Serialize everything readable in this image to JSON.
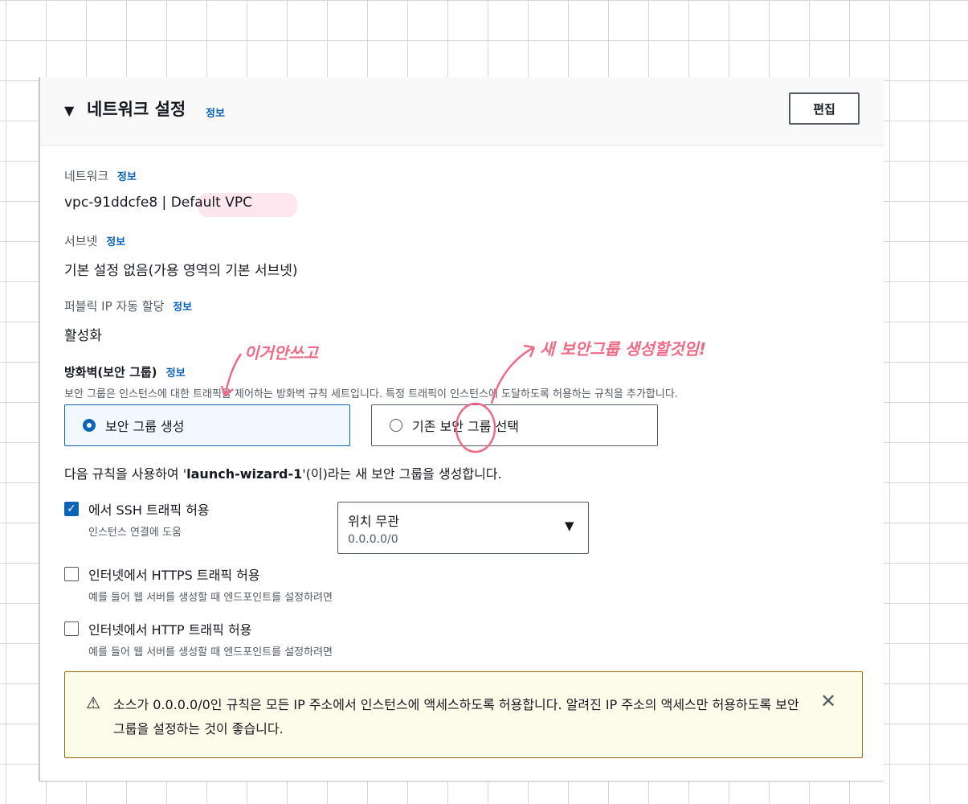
{
  "panel": {
    "title": "네트워크 설정",
    "title_info": "정보",
    "edit_label": "편집"
  },
  "network": {
    "label": "네트워크",
    "info": "정보",
    "value": "vpc-91ddcfe8 | Default VPC"
  },
  "subnet": {
    "label": "서브넷",
    "info": "정보",
    "value": "기본 설정 없음(가용 영역의 기본 서브넷)"
  },
  "public_ip": {
    "label": "퍼블릭 IP 자동 할당",
    "info": "정보",
    "value": "활성화"
  },
  "firewall": {
    "label": "방화벽(보안 그룹)",
    "info": "정보",
    "description": "보안 그룹은 인스턴스에 대한 트래픽을 제어하는 방화벽 규칙 세트입니다. 특정 트래픽이 인스턴스에 도달하도록 허용하는 규칙을 추가합니다.",
    "options": [
      {
        "label": "보안 그룹 생성",
        "selected": true
      },
      {
        "label": "기존 보안 그룹 선택",
        "selected": false
      }
    ],
    "rule_text_prefix": "다음 규칙을 사용하여 '",
    "rule_group_name": "launch-wizard-1",
    "rule_text_suffix": "'(이)라는 새 보안 그룹을 생성합니다."
  },
  "rules": [
    {
      "label": "에서 SSH 트래픽 허용",
      "description": "인스턴스 연결에 도움",
      "checked": true
    },
    {
      "label": "인터넷에서 HTTPS 트래픽 허용",
      "description": "예를 들어 웹 서버를 생성할 때 엔드포인트를 설정하려면",
      "checked": false
    },
    {
      "label": "인터넷에서 HTTP 트래픽 허용",
      "description": "예를 들어 웹 서버를 생성할 때 엔드포인트를 설정하려면",
      "checked": false
    }
  ],
  "ssh_source_select": {
    "value": "위치 무관",
    "detail": "0.0.0.0/0"
  },
  "warning": {
    "icon": "warning-icon",
    "text": "소스가 0.0.0.0/0인 규칙은 모든 IP 주소에서 인스턴스에 액세스하도록 허용합니다. 알려진 IP 주소의 액세스만 허용하도록 보안 그룹을 설정하는 것이 좋습니다."
  },
  "annotations": {
    "left_note": "이거안쓰고",
    "right_note": "새 보안그룹 생성할것임!"
  },
  "colors": {
    "accent": "#0b63b7",
    "annotation": "#f06a86",
    "warning_bg": "#fdfbea"
  }
}
